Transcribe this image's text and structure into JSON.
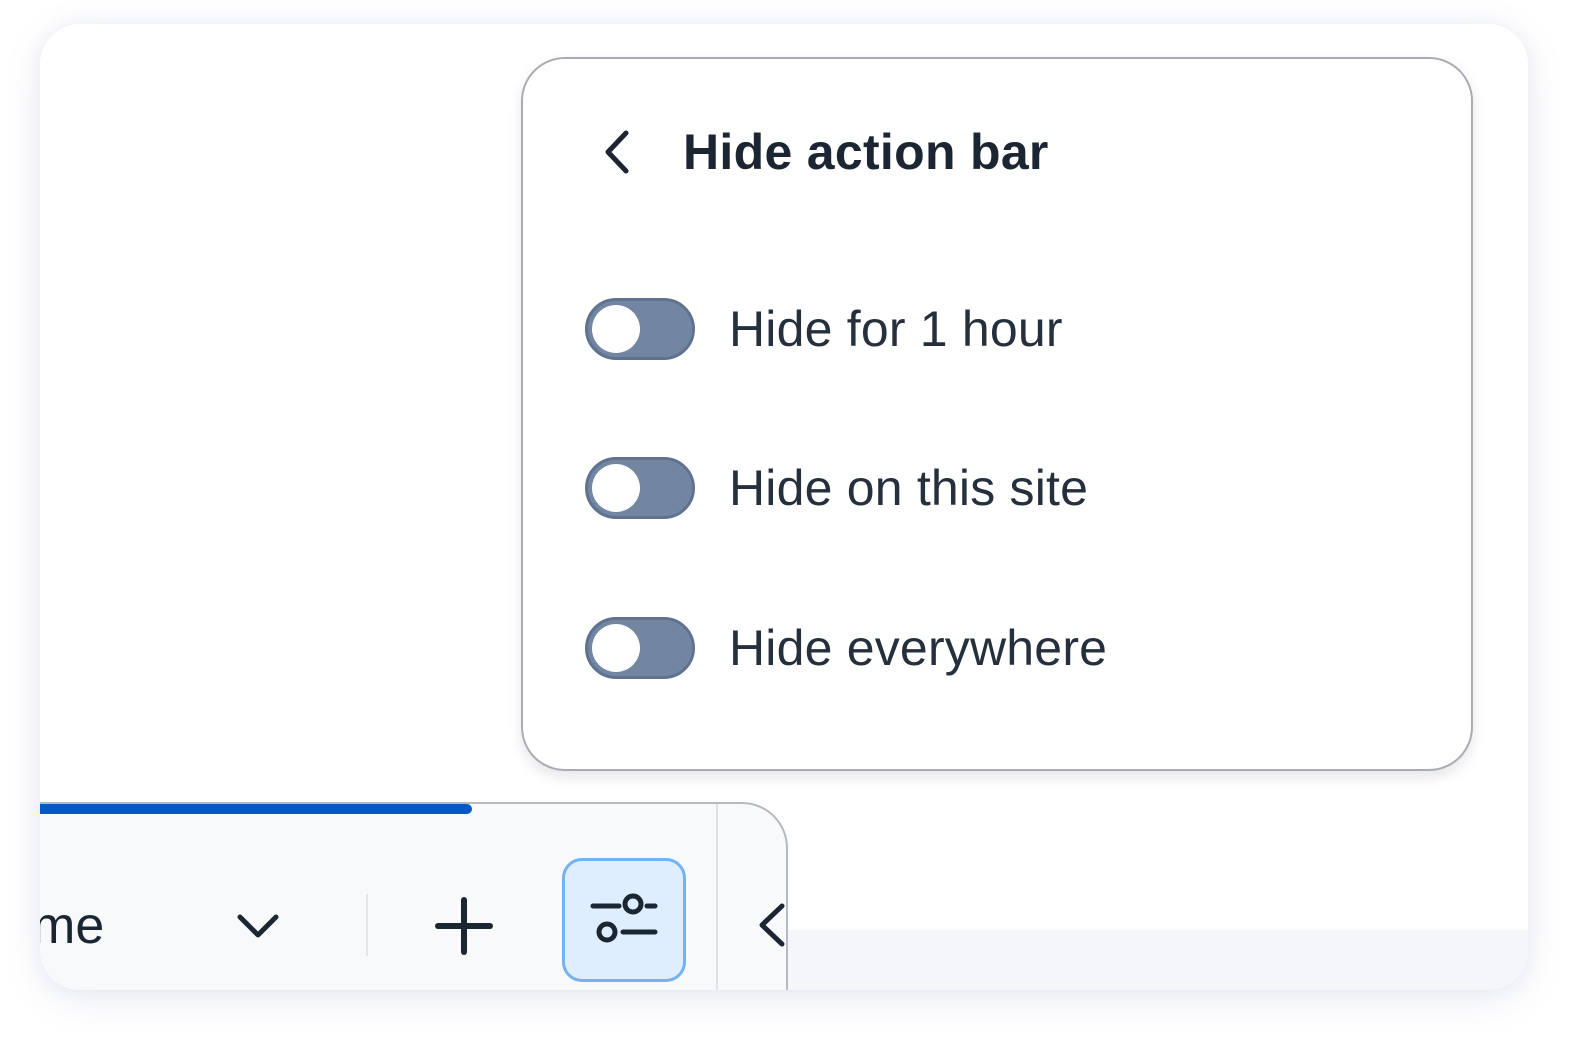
{
  "popover": {
    "title": "Hide action bar",
    "back_icon": "chevron-left-icon",
    "options": [
      {
        "label": "Hide for 1 hour",
        "enabled": false
      },
      {
        "label": "Hide on this site",
        "enabled": false
      },
      {
        "label": "Hide everywhere",
        "enabled": false
      }
    ]
  },
  "action_bar": {
    "partial_text": "me",
    "dropdown_icon": "chevron-down-icon",
    "add_icon": "plus-icon",
    "settings_icon": "sliders-icon",
    "collapse_icon": "chevron-left-icon",
    "progress_fraction": 0.6
  },
  "colors": {
    "accent_blue": "#0a56c6",
    "toggle_off": "#7285a1",
    "settings_bg": "#deeeff",
    "settings_border": "#72b2f5",
    "text_dark": "#1c2633"
  }
}
